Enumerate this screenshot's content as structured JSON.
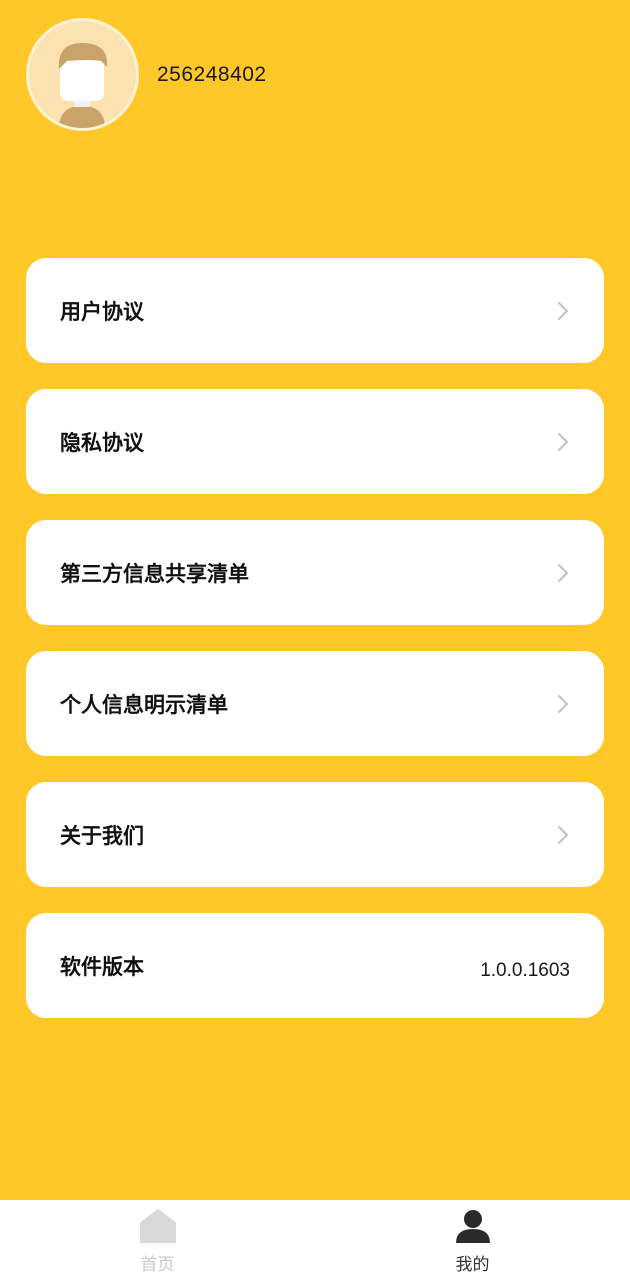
{
  "profile": {
    "user_id": "256248402",
    "avatar_icon": "default-avatar-icon"
  },
  "menu": {
    "items": [
      {
        "label": "用户协议",
        "icon": "chevron-right-icon"
      },
      {
        "label": "隐私协议",
        "icon": "chevron-right-icon"
      },
      {
        "label": "第三方信息共享清单",
        "icon": "chevron-right-icon"
      },
      {
        "label": "个人信息明示清单",
        "icon": "chevron-right-icon"
      },
      {
        "label": "关于我们",
        "icon": "chevron-right-icon"
      }
    ],
    "version": {
      "label": "软件版本",
      "value": "1.0.0.1603"
    }
  },
  "tabbar": {
    "home": {
      "label": "首页",
      "icon": "home-icon"
    },
    "mine": {
      "label": "我的",
      "icon": "user-icon"
    }
  },
  "colors": {
    "background": "#FFC727",
    "card": "#FFFFFF",
    "tab_inactive": "#C8C8C8",
    "tab_active": "#333333"
  }
}
